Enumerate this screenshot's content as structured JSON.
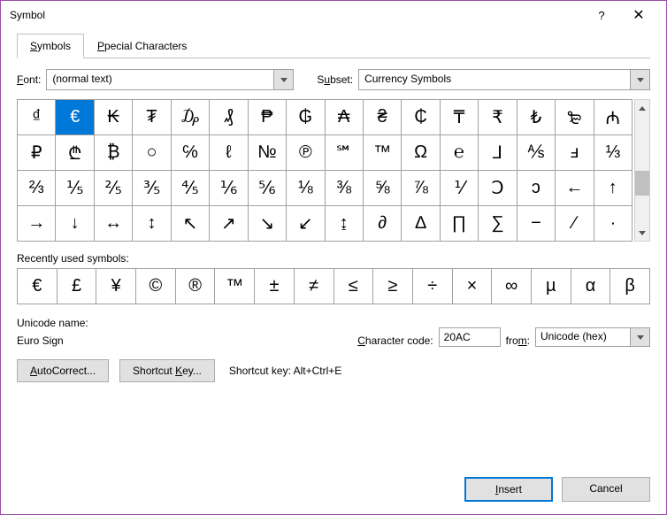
{
  "title": "Symbol",
  "tabs": {
    "symbols": "Symbols",
    "special": "Special Characters"
  },
  "font": {
    "label": "Font:",
    "value": "(normal text)"
  },
  "subset": {
    "label": "Subset:",
    "value": "Currency Symbols"
  },
  "symbols": [
    "₫",
    "€",
    "₭",
    "₮",
    "₯",
    "₰",
    "₱",
    "₲",
    "₳",
    "₴",
    "₵",
    "₸",
    "₹",
    "₺",
    "₻",
    "₼",
    "₽",
    "₾",
    "₿",
    "○",
    "℅",
    "ℓ",
    "№",
    "℗",
    "℠",
    "™",
    "Ω",
    "℮",
    "⅃",
    "⅍",
    "ⅎ",
    "⅓",
    "⅔",
    "⅕",
    "⅖",
    "⅗",
    "⅘",
    "⅙",
    "⅚",
    "⅛",
    "⅜",
    "⅝",
    "⅞",
    "⅟",
    "Ↄ",
    "ↄ",
    "←",
    "↑",
    "→",
    "↓",
    "↔",
    "↕",
    "↖",
    "↗",
    "↘",
    "↙",
    "↨",
    "∂",
    "∆",
    "∏",
    "∑",
    "−",
    "∕",
    "∙"
  ],
  "selected_index": 1,
  "recent_label": "Recently used symbols:",
  "recent": [
    "€",
    "£",
    "¥",
    "©",
    "®",
    "™",
    "±",
    "≠",
    "≤",
    "≥",
    "÷",
    "×",
    "∞",
    "µ",
    "α",
    "β"
  ],
  "unicode_name_label": "Unicode name:",
  "unicode_name": "Euro Sign",
  "char_code_label": "Character code:",
  "char_code": "20AC",
  "from_label": "from:",
  "from_value": "Unicode (hex)",
  "autocorrect_btn": "AutoCorrect...",
  "shortcut_btn": "Shortcut Key...",
  "shortcut_label": "Shortcut key:",
  "shortcut_value": "Alt+Ctrl+E",
  "insert_btn": "Insert",
  "cancel_btn": "Cancel"
}
